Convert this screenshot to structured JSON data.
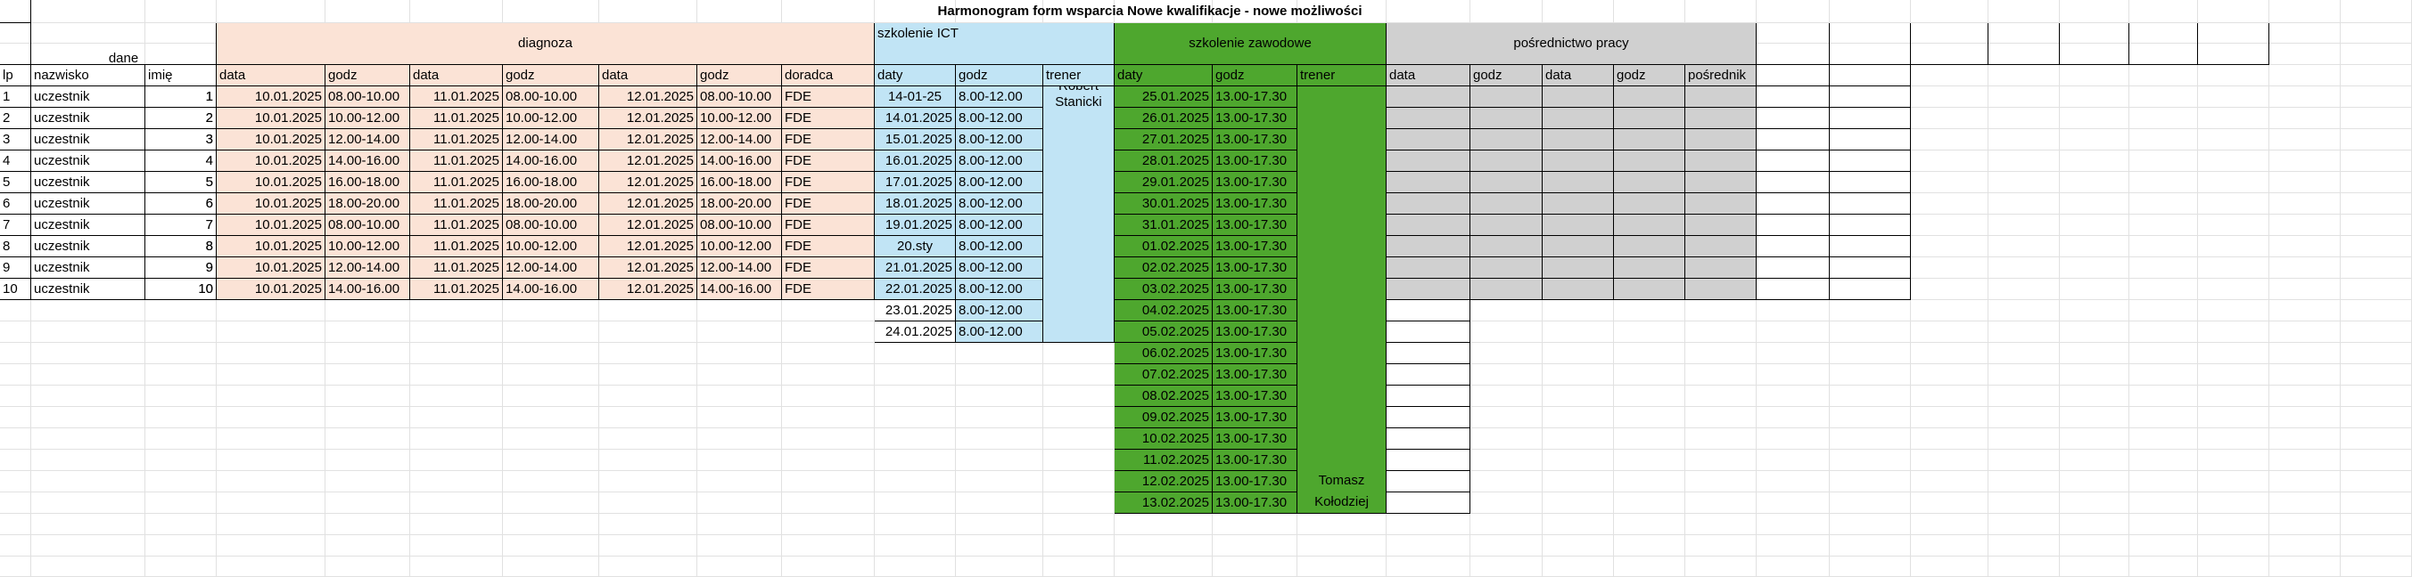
{
  "title": "Harmonogram form wsparcia Nowe kwalifikacje - nowe możliwości",
  "groups": {
    "dane": "dane",
    "diagnoza": "diagnoza",
    "ict": "szkolenie ICT",
    "zawodowe": "szkolenie zawodowe",
    "posrednictwo": "pośrednictwo pracy"
  },
  "headers": [
    "lp",
    "nazwisko",
    "imię",
    "data",
    "godz",
    "data",
    "godz",
    "data",
    "godz",
    "doradca",
    "daty",
    "godz",
    "trener",
    "daty",
    "godz",
    "trener",
    "data",
    "godz",
    "data",
    "godz",
    "pośrednik"
  ],
  "rows": [
    [
      "1",
      "uczestnik",
      "1",
      "10.01.2025",
      "08.00-10.00",
      "11.01.2025",
      "08.00-10.00",
      "12.01.2025",
      "08.00-10.00",
      "FDE",
      "14-01-25",
      "8.00-12.00",
      "25.01.2025",
      "13.00-17.30"
    ],
    [
      "2",
      "uczestnik",
      "2",
      "10.01.2025",
      "10.00-12.00",
      "11.01.2025",
      "10.00-12.00",
      "12.01.2025",
      "10.00-12.00",
      "FDE",
      "14.01.2025",
      "8.00-12.00",
      "26.01.2025",
      "13.00-17.30"
    ],
    [
      "3",
      "uczestnik",
      "3",
      "10.01.2025",
      "12.00-14.00",
      "11.01.2025",
      "12.00-14.00",
      "12.01.2025",
      "12.00-14.00",
      "FDE",
      "15.01.2025",
      "8.00-12.00",
      "27.01.2025",
      "13.00-17.30"
    ],
    [
      "4",
      "uczestnik",
      "4",
      "10.01.2025",
      "14.00-16.00",
      "11.01.2025",
      "14.00-16.00",
      "12.01.2025",
      "14.00-16.00",
      "FDE",
      "16.01.2025",
      "8.00-12.00",
      "28.01.2025",
      "13.00-17.30"
    ],
    [
      "5",
      "uczestnik",
      "5",
      "10.01.2025",
      "16.00-18.00",
      "11.01.2025",
      "16.00-18.00",
      "12.01.2025",
      "16.00-18.00",
      "FDE",
      "17.01.2025",
      "8.00-12.00",
      "29.01.2025",
      "13.00-17.30"
    ],
    [
      "6",
      "uczestnik",
      "6",
      "10.01.2025",
      "18.00-20.00",
      "11.01.2025",
      "18.00-20.00",
      "12.01.2025",
      "18.00-20.00",
      "FDE",
      "18.01.2025",
      "8.00-12.00",
      "30.01.2025",
      "13.00-17.30"
    ],
    [
      "7",
      "uczestnik",
      "7",
      "10.01.2025",
      "08.00-10.00",
      "11.01.2025",
      "08.00-10.00",
      "12.01.2025",
      "08.00-10.00",
      "FDE",
      "19.01.2025",
      "8.00-12.00",
      "31.01.2025",
      "13.00-17.30"
    ],
    [
      "8",
      "uczestnik",
      "8",
      "10.01.2025",
      "10.00-12.00",
      "11.01.2025",
      "10.00-12.00",
      "12.01.2025",
      "10.00-12.00",
      "FDE",
      "20.sty",
      "8.00-12.00",
      "01.02.2025",
      "13.00-17.30"
    ],
    [
      "9",
      "uczestnik",
      "9",
      "10.01.2025",
      "12.00-14.00",
      "11.01.2025",
      "12.00-14.00",
      "12.01.2025",
      "12.00-14.00",
      "FDE",
      "21.01.2025",
      "8.00-12.00",
      "02.02.2025",
      "13.00-17.30"
    ],
    [
      "10",
      "uczestnik",
      "10",
      "10.01.2025",
      "14.00-16.00",
      "11.01.2025",
      "14.00-16.00",
      "12.01.2025",
      "14.00-16.00",
      "FDE",
      "22.01.2025",
      "8.00-12.00",
      "03.02.2025",
      "13.00-17.30"
    ]
  ],
  "ict_extra": [
    [
      "23.01.2025",
      "8.00-12.00"
    ],
    [
      "24.01.2025",
      "8.00-12.00"
    ]
  ],
  "zaw_extra": [
    "04.02.2025",
    "05.02.2025",
    "06.02.2025",
    "07.02.2025",
    "08.02.2025",
    "09.02.2025",
    "10.02.2025",
    "11.02.2025",
    "12.02.2025",
    "13.02.2025"
  ],
  "zaw_godz": "13.00-17.30",
  "ict_trainer": "Robert Stanicki",
  "zaw_trainer": "Tomasz Kołodziej",
  "colors": {
    "pink": "#fbe3d6",
    "blue": "#c1e4f5",
    "green": "#4ea72e",
    "grey": "#d0d0d0"
  }
}
